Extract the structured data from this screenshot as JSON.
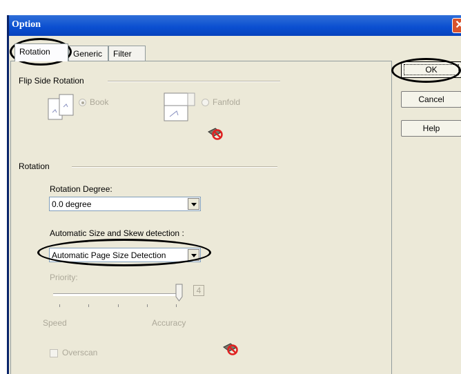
{
  "window": {
    "title": "Option"
  },
  "tabs": [
    {
      "label": "Rotation",
      "active": true
    },
    {
      "label": "Generic",
      "active": false
    },
    {
      "label": "Filter",
      "active": false
    }
  ],
  "buttons": {
    "ok": "OK",
    "cancel": "Cancel",
    "help": "Help"
  },
  "flip_side": {
    "group_label": "Flip Side Rotation",
    "book": {
      "label": "Book",
      "selected": true
    },
    "fanfold": {
      "label": "Fanfold",
      "selected": false
    }
  },
  "rotation": {
    "group_label": "Rotation",
    "degree_label": "Rotation Degree:",
    "degree_value": "0.0 degree",
    "detection_label": "Automatic Size and Skew detection :",
    "detection_value": "Automatic Page Size Detection",
    "priority_label": "Priority:",
    "priority_value": "4",
    "slider_min_label": "Speed",
    "slider_max_label": "Accuracy",
    "overscan_label": "Overscan",
    "overscan_checked": false
  },
  "colors": {
    "title_bar": "#0a4ed0",
    "dialog_bg": "#ece9d8",
    "disabled_text": "#aca899"
  }
}
